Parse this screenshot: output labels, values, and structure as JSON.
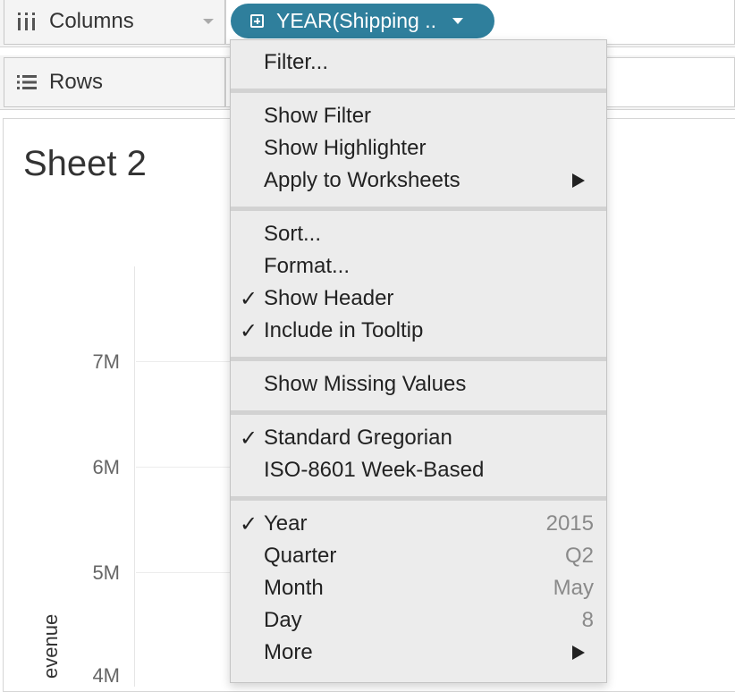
{
  "shelves": {
    "columns_label": "Columns",
    "rows_label": "Rows"
  },
  "pill": {
    "label": "YEAR(Shipping .."
  },
  "sheet": {
    "title": "Sheet 2",
    "y_axis_label": "evenue",
    "ticks": [
      "7M",
      "6M",
      "5M",
      "4M"
    ]
  },
  "menu": {
    "filter": "Filter...",
    "show_filter": "Show Filter",
    "show_highlighter": "Show Highlighter",
    "apply_to_worksheets": "Apply to Worksheets",
    "sort": "Sort...",
    "format": "Format...",
    "show_header": "Show Header",
    "include_in_tooltip": "Include in Tooltip",
    "show_missing_values": "Show Missing Values",
    "standard_gregorian": "Standard Gregorian",
    "iso_week_based": "ISO-8601 Week-Based",
    "year": "Year",
    "year_value": "2015",
    "quarter": "Quarter",
    "quarter_value": "Q2",
    "month": "Month",
    "month_value": "May",
    "day": "Day",
    "day_value": "8",
    "more": "More",
    "check_mark": "✓"
  },
  "colors": {
    "pill": "#2f7f9c",
    "menu_bg": "#ececec",
    "shelf_bg": "#f4f4f4"
  }
}
